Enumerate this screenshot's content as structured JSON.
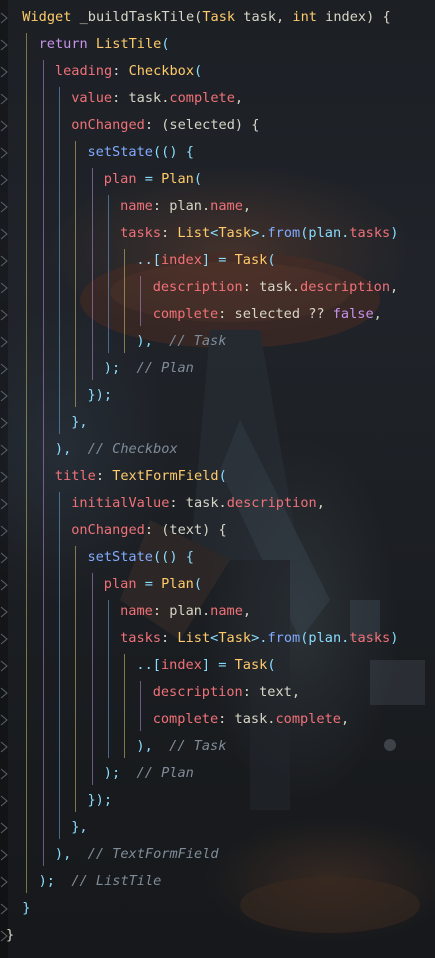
{
  "editor": {
    "language": "dart",
    "colors": {
      "keyword": "#c792ea",
      "type": "#ffcb6b",
      "function": "#82aaff",
      "property": "#f07178",
      "punctuation": "#89ddff",
      "comment": "#7f8c98"
    },
    "lines": [
      {
        "indent": 1,
        "tokens": [
          {
            "t": "Widget",
            "c": "ty"
          },
          {
            "t": " _buildTaskTile(",
            "c": "pl"
          },
          {
            "t": "Task",
            "c": "ty"
          },
          {
            "t": " task, ",
            "c": "pl"
          },
          {
            "t": "int",
            "c": "ty"
          },
          {
            "t": " index) {",
            "c": "pl"
          }
        ]
      },
      {
        "indent": 2,
        "tokens": [
          {
            "t": "return",
            "c": "kw"
          },
          {
            "t": " ",
            "c": "pl"
          },
          {
            "t": "ListTile",
            "c": "ty"
          },
          {
            "t": "(",
            "c": "pu"
          }
        ]
      },
      {
        "indent": 3,
        "tokens": [
          {
            "t": "leading",
            "c": "pr"
          },
          {
            "t": ": ",
            "c": "pl"
          },
          {
            "t": "Checkbox",
            "c": "ty"
          },
          {
            "t": "(",
            "c": "pu"
          }
        ]
      },
      {
        "indent": 4,
        "tokens": [
          {
            "t": "value",
            "c": "pr"
          },
          {
            "t": ": task.",
            "c": "pl"
          },
          {
            "t": "complete",
            "c": "pr"
          },
          {
            "t": ",",
            "c": "pl"
          }
        ]
      },
      {
        "indent": 4,
        "tokens": [
          {
            "t": "onChanged",
            "c": "pr"
          },
          {
            "t": ": (selected) {",
            "c": "pl"
          }
        ]
      },
      {
        "indent": 5,
        "tokens": [
          {
            "t": "setState",
            "c": "fn"
          },
          {
            "t": "(() {",
            "c": "pu"
          }
        ]
      },
      {
        "indent": 6,
        "tokens": [
          {
            "t": "plan",
            "c": "pr"
          },
          {
            "t": " = ",
            "c": "pu"
          },
          {
            "t": "Plan",
            "c": "ty"
          },
          {
            "t": "(",
            "c": "pu"
          }
        ]
      },
      {
        "indent": 7,
        "tokens": [
          {
            "t": "name",
            "c": "pr"
          },
          {
            "t": ": plan.",
            "c": "pl"
          },
          {
            "t": "name",
            "c": "pr"
          },
          {
            "t": ",",
            "c": "pl"
          }
        ]
      },
      {
        "indent": 7,
        "tokens": [
          {
            "t": "tasks",
            "c": "pr"
          },
          {
            "t": ": ",
            "c": "pl"
          },
          {
            "t": "List",
            "c": "ty"
          },
          {
            "t": "<",
            "c": "pu"
          },
          {
            "t": "Task",
            "c": "ty"
          },
          {
            "t": ">.",
            "c": "pu"
          },
          {
            "t": "from",
            "c": "fn"
          },
          {
            "t": "(plan.",
            "c": "pu"
          },
          {
            "t": "tasks",
            "c": "pr"
          },
          {
            "t": ")",
            "c": "pu"
          }
        ]
      },
      {
        "indent": 8,
        "tokens": [
          {
            "t": "..[",
            "c": "pu"
          },
          {
            "t": "index",
            "c": "pr"
          },
          {
            "t": "] = ",
            "c": "pu"
          },
          {
            "t": "Task",
            "c": "ty"
          },
          {
            "t": "(",
            "c": "pu"
          }
        ]
      },
      {
        "indent": 9,
        "tokens": [
          {
            "t": "description",
            "c": "pr"
          },
          {
            "t": ": task.",
            "c": "pl"
          },
          {
            "t": "description",
            "c": "pr"
          },
          {
            "t": ",",
            "c": "pl"
          }
        ]
      },
      {
        "indent": 9,
        "tokens": [
          {
            "t": "complete",
            "c": "pr"
          },
          {
            "t": ": selected ?? ",
            "c": "pl"
          },
          {
            "t": "false",
            "c": "kw"
          },
          {
            "t": ",",
            "c": "pl"
          }
        ]
      },
      {
        "indent": 8,
        "tokens": [
          {
            "t": "),",
            "c": "pu"
          },
          {
            "t": "  // Task",
            "c": "cm"
          }
        ]
      },
      {
        "indent": 6,
        "tokens": [
          {
            "t": ");",
            "c": "pu"
          },
          {
            "t": "  // Plan",
            "c": "cm"
          }
        ]
      },
      {
        "indent": 5,
        "tokens": [
          {
            "t": "});",
            "c": "pu"
          }
        ]
      },
      {
        "indent": 4,
        "tokens": [
          {
            "t": "},",
            "c": "pu"
          }
        ]
      },
      {
        "indent": 3,
        "tokens": [
          {
            "t": "),",
            "c": "pu"
          },
          {
            "t": "  // Checkbox",
            "c": "cm"
          }
        ]
      },
      {
        "indent": 3,
        "tokens": [
          {
            "t": "title",
            "c": "pr"
          },
          {
            "t": ": ",
            "c": "pl"
          },
          {
            "t": "TextFormField",
            "c": "ty"
          },
          {
            "t": "(",
            "c": "pu"
          }
        ]
      },
      {
        "indent": 4,
        "tokens": [
          {
            "t": "initialValue",
            "c": "pr"
          },
          {
            "t": ": task.",
            "c": "pl"
          },
          {
            "t": "description",
            "c": "pr"
          },
          {
            "t": ",",
            "c": "pl"
          }
        ]
      },
      {
        "indent": 4,
        "tokens": [
          {
            "t": "onChanged",
            "c": "pr"
          },
          {
            "t": ": (text) {",
            "c": "pl"
          }
        ]
      },
      {
        "indent": 5,
        "tokens": [
          {
            "t": "setState",
            "c": "fn"
          },
          {
            "t": "(() {",
            "c": "pu"
          }
        ]
      },
      {
        "indent": 6,
        "tokens": [
          {
            "t": "plan",
            "c": "pr"
          },
          {
            "t": " = ",
            "c": "pu"
          },
          {
            "t": "Plan",
            "c": "ty"
          },
          {
            "t": "(",
            "c": "pu"
          }
        ]
      },
      {
        "indent": 7,
        "tokens": [
          {
            "t": "name",
            "c": "pr"
          },
          {
            "t": ": plan.",
            "c": "pl"
          },
          {
            "t": "name",
            "c": "pr"
          },
          {
            "t": ",",
            "c": "pl"
          }
        ]
      },
      {
        "indent": 7,
        "tokens": [
          {
            "t": "tasks",
            "c": "pr"
          },
          {
            "t": ": ",
            "c": "pl"
          },
          {
            "t": "List",
            "c": "ty"
          },
          {
            "t": "<",
            "c": "pu"
          },
          {
            "t": "Task",
            "c": "ty"
          },
          {
            "t": ">.",
            "c": "pu"
          },
          {
            "t": "from",
            "c": "fn"
          },
          {
            "t": "(plan.",
            "c": "pu"
          },
          {
            "t": "tasks",
            "c": "pr"
          },
          {
            "t": ")",
            "c": "pu"
          }
        ]
      },
      {
        "indent": 8,
        "tokens": [
          {
            "t": "..[",
            "c": "pu"
          },
          {
            "t": "index",
            "c": "pr"
          },
          {
            "t": "] = ",
            "c": "pu"
          },
          {
            "t": "Task",
            "c": "ty"
          },
          {
            "t": "(",
            "c": "pu"
          }
        ]
      },
      {
        "indent": 9,
        "tokens": [
          {
            "t": "description",
            "c": "pr"
          },
          {
            "t": ": text,",
            "c": "pl"
          }
        ]
      },
      {
        "indent": 9,
        "tokens": [
          {
            "t": "complete",
            "c": "pr"
          },
          {
            "t": ": task.",
            "c": "pl"
          },
          {
            "t": "complete",
            "c": "pr"
          },
          {
            "t": ",",
            "c": "pl"
          }
        ]
      },
      {
        "indent": 8,
        "tokens": [
          {
            "t": "),",
            "c": "pu"
          },
          {
            "t": "  // Task",
            "c": "cm"
          }
        ]
      },
      {
        "indent": 6,
        "tokens": [
          {
            "t": ");",
            "c": "pu"
          },
          {
            "t": "  // Plan",
            "c": "cm"
          }
        ]
      },
      {
        "indent": 5,
        "tokens": [
          {
            "t": "});",
            "c": "pu"
          }
        ]
      },
      {
        "indent": 4,
        "tokens": [
          {
            "t": "},",
            "c": "pu"
          }
        ]
      },
      {
        "indent": 3,
        "tokens": [
          {
            "t": "),",
            "c": "pu"
          },
          {
            "t": "  // TextFormField",
            "c": "cm"
          }
        ]
      },
      {
        "indent": 2,
        "tokens": [
          {
            "t": ");",
            "c": "pu"
          },
          {
            "t": "  // ListTile",
            "c": "cm"
          }
        ]
      },
      {
        "indent": 1,
        "tokens": [
          {
            "t": "}",
            "c": "pu"
          }
        ]
      },
      {
        "indent": 0,
        "tokens": [
          {
            "t": "}",
            "c": "pl"
          }
        ]
      }
    ]
  }
}
